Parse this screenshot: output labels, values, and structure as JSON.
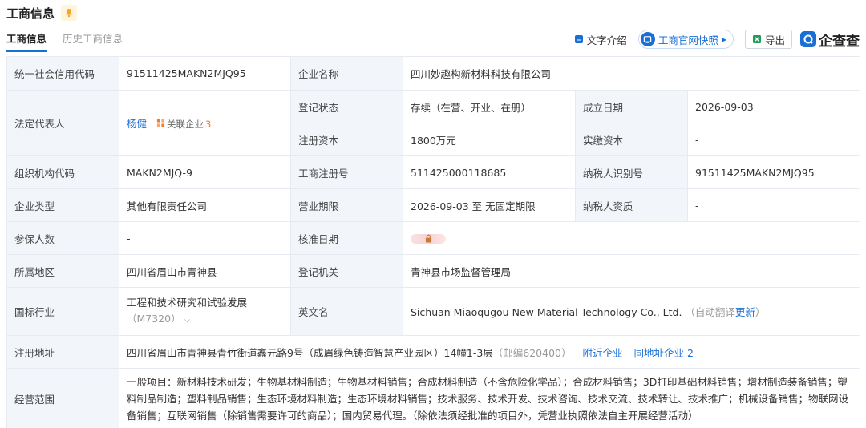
{
  "header": {
    "title": "工商信息"
  },
  "tabs": [
    {
      "label": "工商信息"
    },
    {
      "label": "历史工商信息"
    }
  ],
  "toolbar": {
    "text_intro": "文字介绍",
    "snapshot": "工商官网快照",
    "export": "导出",
    "brand": "企查查"
  },
  "colors": {
    "accent": "#1a6fd4",
    "label_bg": "#f2f6fb",
    "border": "#e6ebf2",
    "badge_orange": "#f57b2e"
  },
  "table": {
    "credit_code_label": "统一社会信用代码",
    "credit_code": "91511425MAKN2MJQ95",
    "company_name_label": "企业名称",
    "company_name": "四川妙趣构新材料科技有限公司",
    "legal_rep_label": "法定代表人",
    "legal_rep": "杨健",
    "related_label": "关联企业",
    "related_count": "3",
    "reg_status_label": "登记状态",
    "reg_status": "存续（在营、开业、在册）",
    "founded_label": "成立日期",
    "founded": "2026-09-03",
    "reg_capital_label": "注册资本",
    "reg_capital": "1800万元",
    "paid_capital_label": "实缴资本",
    "paid_capital": "-",
    "org_code_label": "组织机构代码",
    "org_code": "MAKN2MJQ-9",
    "biz_reg_no_label": "工商注册号",
    "biz_reg_no": "511425000118685",
    "taxpayer_id_label": "纳税人识别号",
    "taxpayer_id": "91511425MAKN2MJQ95",
    "company_type_label": "企业类型",
    "company_type": "其他有限责任公司",
    "term_label": "营业期限",
    "term": "2026-09-03 至 无固定期限",
    "taxpayer_qual_label": "纳税人资质",
    "taxpayer_qual": "-",
    "insured_label": "参保人数",
    "insured": "-",
    "approval_date_label": "核准日期",
    "region_label": "所属地区",
    "region": "四川省眉山市青神县",
    "authority_label": "登记机关",
    "authority": "青神县市场监督管理局",
    "industry_label": "国标行业",
    "industry": "工程和技术研究和试验发展",
    "industry_code": "（M7320）",
    "english_name_label": "英文名",
    "english_name": "Sichuan Miaoqugou New Material Technology Co., Ltd.",
    "auto_translate": "（自动翻译",
    "update_link": "更新",
    "auto_translate_end": "）",
    "address_label": "注册地址",
    "address": "四川省眉山市青神县青竹街道鑫元路9号（成眉绿色铸造智慧产业园区）14幢1-3层",
    "postcode": "（邮编620400）",
    "nearby_link": "附近企业",
    "same_address_link": "同地址企业 2",
    "scope_label": "经营范围",
    "scope": "一般项目：新材料技术研发；生物基材料制造；生物基材料销售；合成材料制造（不含危险化学品）；合成材料销售；3D打印基础材料销售；增材制造装备销售；塑料制品制造；塑料制品销售；生态环境材料制造；生态环境材料销售；技术服务、技术开发、技术咨询、技术交流、技术转让、技术推广；机械设备销售；物联网设备销售；互联网销售（除销售需要许可的商品）；国内贸易代理。（除依法须经批准的项目外，凭营业执照依法自主开展经营活动）"
  }
}
